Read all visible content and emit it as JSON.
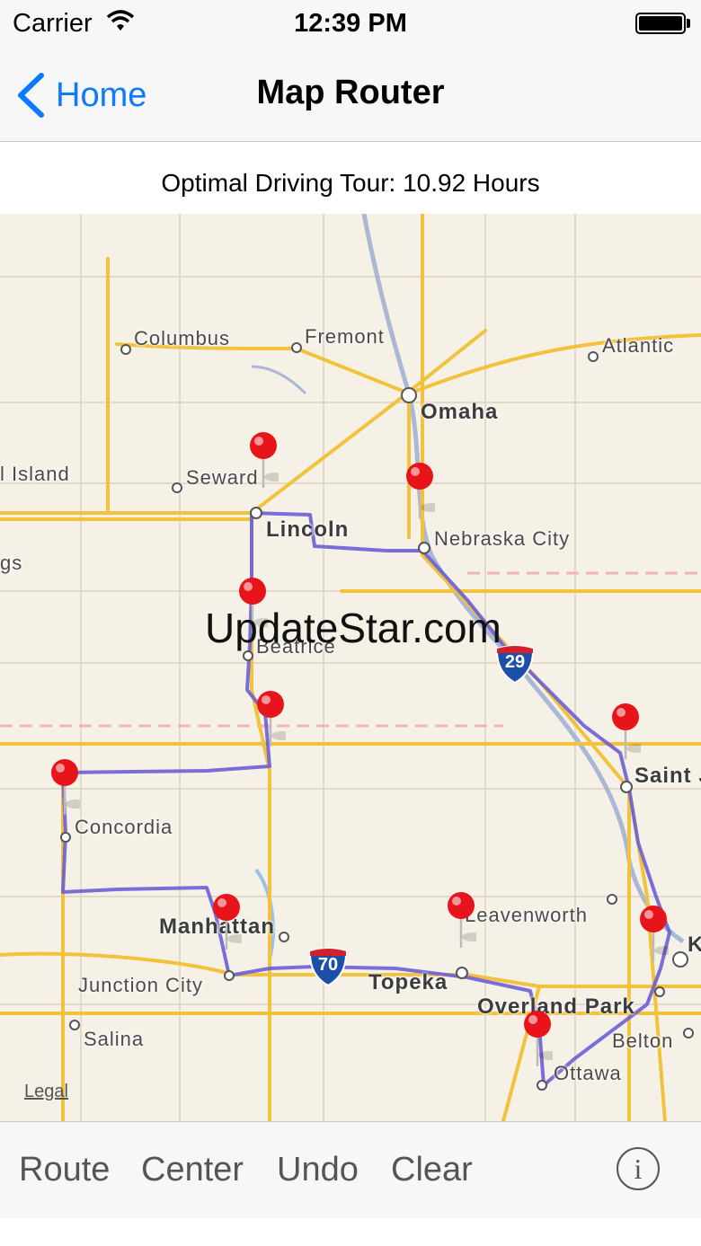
{
  "status_bar": {
    "carrier": "Carrier",
    "time": "12:39 PM"
  },
  "nav": {
    "back_label": "Home",
    "title": "Map Router"
  },
  "summary": {
    "text": "Optimal Driving Tour: 10.92 Hours"
  },
  "map": {
    "cities": {
      "columbus": "Columbus",
      "fremont": "Fremont",
      "atlantic": "Atlantic",
      "omaha": "Omaha",
      "grand_island": "l Island",
      "seward": "Seward",
      "lincoln": "Lincoln",
      "hastings": "gs",
      "nebraska_city": "Nebraska City",
      "beatrice": "Beatrice",
      "saint_joseph": "Saint J",
      "concordia": "Concordia",
      "manhattan": "Manhattan",
      "leavenworth": "Leavenworth",
      "junction_city": "Junction City",
      "topeka": "Topeka",
      "overland_park": "Overland Park",
      "salina": "Salina",
      "belton": "Belton",
      "ottawa": "Ottawa",
      "kc": "K"
    },
    "shields": {
      "i29": "29",
      "i70": "70"
    },
    "legal": "Legal",
    "watermark": "UpdateStar.com",
    "route_color": "#6b5fd6",
    "pin_color": "#e8141c"
  },
  "toolbar": {
    "route": "Route",
    "center": "Center",
    "undo": "Undo",
    "clear": "Clear",
    "info_icon": "info-icon"
  }
}
